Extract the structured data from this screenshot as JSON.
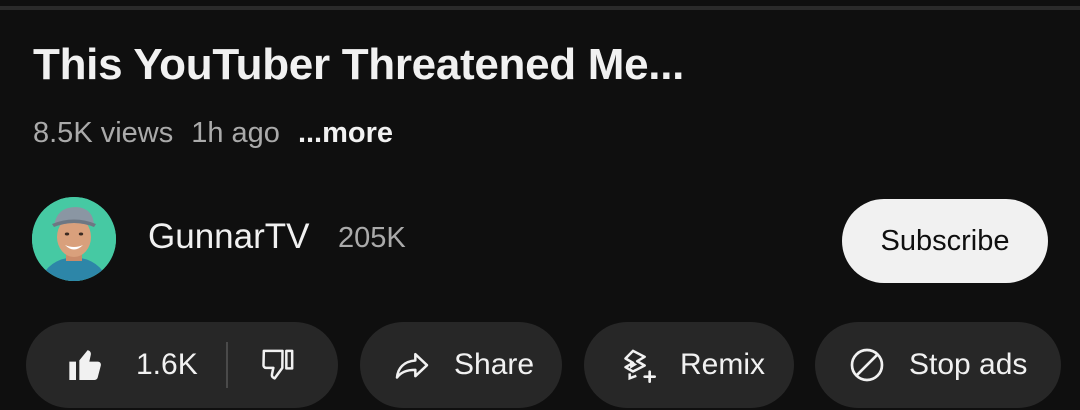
{
  "video": {
    "title": "This YouTuber Threatened Me...",
    "views": "8.5K views",
    "age": "1h ago",
    "more_label": "...more"
  },
  "channel": {
    "name": "GunnarTV",
    "subscribers": "205K",
    "avatar_bg": "#46c9a3"
  },
  "subscribe": {
    "label": "Subscribe"
  },
  "actions": {
    "like_count": "1.6K",
    "share_label": "Share",
    "remix_label": "Remix",
    "stop_ads_label": "Stop ads"
  },
  "icons": {
    "like": "thumbs-up-icon",
    "dislike": "thumbs-down-icon",
    "share": "share-arrow-icon",
    "remix": "remix-icon",
    "stop_ads": "no-entry-icon"
  },
  "colors": {
    "background": "#0f0f0f",
    "pill": "#272727",
    "text": "#f1f1f1",
    "secondary_text": "#aaaaaa",
    "subscribe_bg": "#f1f1f1"
  }
}
